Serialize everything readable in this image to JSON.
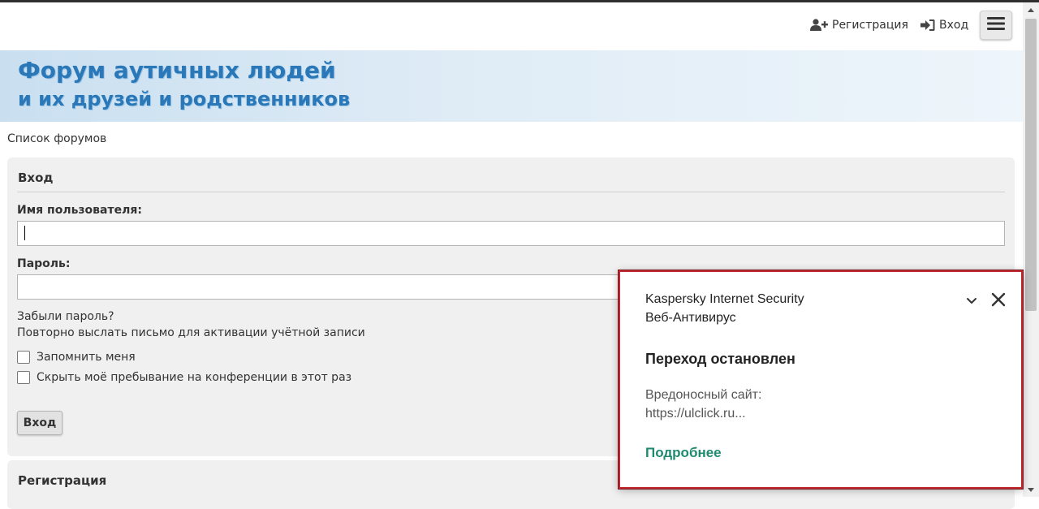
{
  "header": {
    "register_label": "Регистрация",
    "login_label": "Вход",
    "register_icon": "user-plus-icon",
    "login_icon": "sign-in-icon",
    "menu_icon": "hamburger-icon"
  },
  "banner": {
    "line1": "Форум аутичных людей",
    "line2": "и их друзей и родственников",
    "text_color": "#2a78b8"
  },
  "breadcrumb": {
    "label": "Список форумов"
  },
  "login_form": {
    "title": "Вход",
    "username_label": "Имя пользователя:",
    "username_value": "",
    "password_label": "Пароль:",
    "password_value": "",
    "forgot_password": "Забыли пароль?",
    "resend_activation": "Повторно выслать письмо для активации учётной записи",
    "remember_me": "Запомнить меня",
    "remember_me_checked": false,
    "hide_online": "Скрыть моё пребывание на конференции в этот раз",
    "hide_online_checked": false,
    "submit_label": "Вход"
  },
  "register_section": {
    "title": "Регистрация"
  },
  "kaspersky_popup": {
    "product": "Kaspersky Internet Security",
    "component": "Веб-Антивирус",
    "heading": "Переход остановлен",
    "reason": "Вредоносный сайт:",
    "url": "https://ulclick.ru...",
    "details_link": "Подробнее",
    "border_color": "#c0282f",
    "link_color": "#1f8a70"
  }
}
